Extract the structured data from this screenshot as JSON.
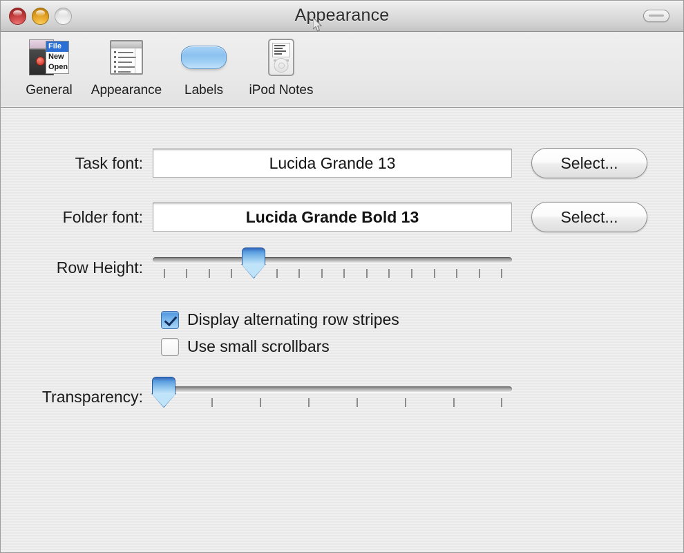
{
  "window": {
    "title": "Appearance",
    "traffic_lights": [
      "close-button",
      "minimize-button",
      "zoom-button"
    ],
    "toolbar_toggle": "toolbar-toggle-button"
  },
  "toolbar": {
    "items": [
      {
        "label": "General",
        "icon": "menu-document-icon",
        "selected": false
      },
      {
        "label": "Appearance",
        "icon": "list-window-icon",
        "selected": true
      },
      {
        "label": "Labels",
        "icon": "blue-pill-icon",
        "selected": false
      },
      {
        "label": "iPod Notes",
        "icon": "ipod-icon",
        "selected": false
      }
    ],
    "general_icon_menu": {
      "item_1": "File",
      "item_2": "New",
      "item_3": "Open"
    }
  },
  "form": {
    "task_font": {
      "label": "Task font:",
      "value": "Lucida Grande 13",
      "button": "Select..."
    },
    "folder_font": {
      "label": "Folder font:",
      "value": "Lucida Grande Bold 13",
      "button": "Select..."
    },
    "row_height": {
      "label": "Row Height:",
      "value": 4,
      "min": 0,
      "max": 15,
      "tick_count": 16,
      "percent": 28
    },
    "transparency": {
      "label": "Transparency:",
      "value": 0,
      "min": 0,
      "max": 7,
      "tick_count": 8,
      "percent": 1
    },
    "checkboxes": [
      {
        "label": "Display alternating row stripes",
        "checked": true
      },
      {
        "label": "Use small scrollbars",
        "checked": false
      }
    ]
  },
  "colors": {
    "accent_blue": "#4c92df",
    "thumb_blue_top": "#2f64b8",
    "thumb_blue_bottom": "#cfe9fb",
    "close_red": "#de5b5b",
    "minimize_yellow": "#f2b840",
    "window_bg": "#ededed",
    "titlebar_bg": "#dcdcdc"
  }
}
